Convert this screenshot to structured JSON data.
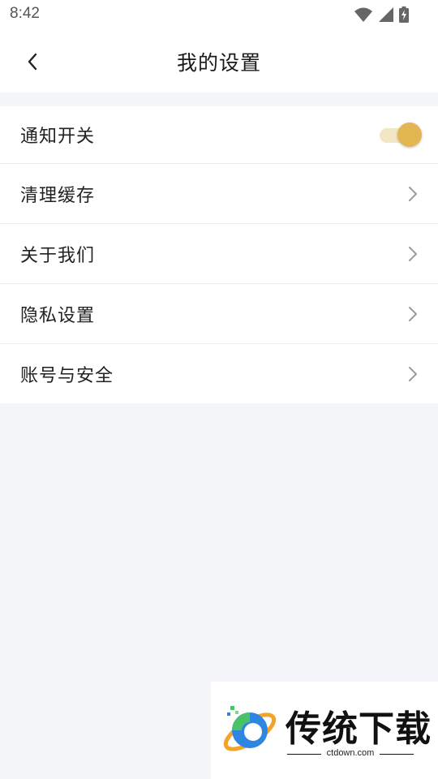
{
  "status_bar": {
    "time": "8:42",
    "icons": [
      "wifi-icon",
      "cell-signal-icon",
      "battery-charging-icon"
    ]
  },
  "header": {
    "back_icon": "chevron-left-icon",
    "title": "我的设置"
  },
  "settings": {
    "notification": {
      "label": "通知开关",
      "enabled": true
    },
    "items": [
      {
        "label": "清理缓存",
        "icon": "chevron-right-icon"
      },
      {
        "label": "关于我们",
        "icon": "chevron-right-icon"
      },
      {
        "label": "隐私设置",
        "icon": "chevron-right-icon"
      },
      {
        "label": "账号与安全",
        "icon": "chevron-right-icon"
      }
    ]
  },
  "watermark": {
    "title": "传统下载",
    "subtitle": "ctdown.com"
  },
  "colors": {
    "background": "#f3f5f8",
    "surface": "#ffffff",
    "accent": "#e2b752",
    "accent_track": "#f2e6c4",
    "text_primary": "#222222",
    "chevron": "#9a9a9a"
  }
}
